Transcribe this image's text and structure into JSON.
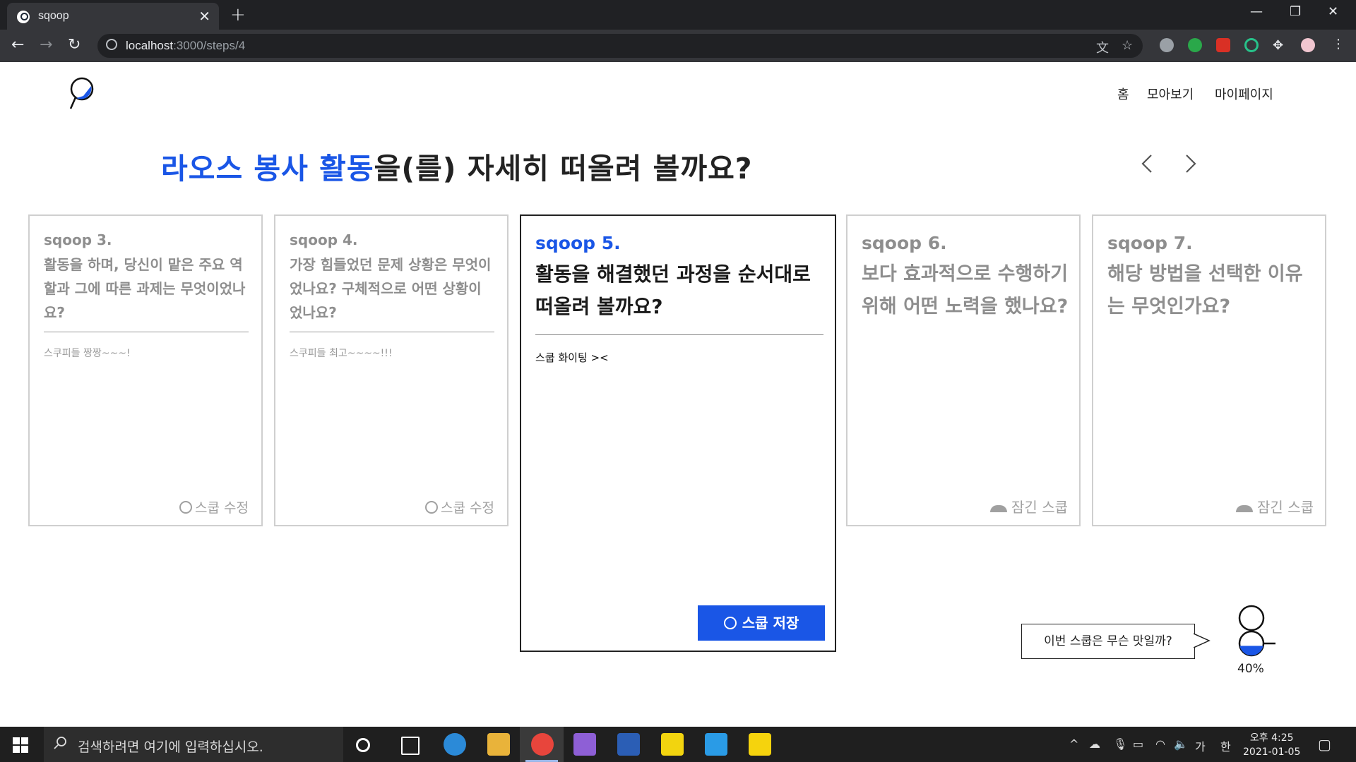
{
  "browser": {
    "tab_title": "sqoop",
    "url_host": "localhost",
    "url_path": ":3000/steps/4",
    "new_tab": "+",
    "close_tab": "✕"
  },
  "nav": {
    "home": "홈",
    "collection": "모아보기",
    "mypage": "마이페이지"
  },
  "heading": {
    "accent": "라오스 봉사 활동",
    "rest": "을(를) 자세히 떠올려 볼까요?"
  },
  "cards": [
    {
      "num": "sqoop 3.",
      "question": "활동을 하며, 당신이 맡은 주요 역할과 그에 따른 과제는 무엇이었나요?",
      "answer": "스쿠피들 짱짱~~~!",
      "action": "스쿱 수정",
      "state": "done"
    },
    {
      "num": "sqoop 4.",
      "question": "가장 힘들었던 문제 상황은 무엇이었나요? 구체적으로 어떤 상황이었나요?",
      "answer": "스쿠피들 최고~~~~!!!",
      "action": "스쿱 수정",
      "state": "done"
    },
    {
      "num": "sqoop 5.",
      "question": "활동을 해결했던 과정을 순서대로 떠올려 볼까요?",
      "answer": "스쿱 화이팅 ><",
      "action": "스쿱 저장",
      "state": "active"
    },
    {
      "num": "sqoop 6.",
      "question": "보다 효과적으로 수행하기 위해 어떤 노력을 했나요?",
      "action": "잠긴 스쿱",
      "state": "locked"
    },
    {
      "num": "sqoop 7.",
      "question": "해당 방법을 선택한 이유는 무엇인가요?",
      "action": "잠긴 스쿱",
      "state": "locked"
    }
  ],
  "mascot": {
    "bubble": "이번 스쿱은 무슨 맛일까?",
    "progress_percent": 40,
    "progress_label": "40%"
  },
  "taskbar": {
    "search_placeholder": "검색하려면 여기에 입력하십시오.",
    "time": "오후 4:25",
    "date": "2021-01-05",
    "ime_lang": "가",
    "ime_mode": "한"
  },
  "colors": {
    "accent": "#1a56e6",
    "chrome_dark": "#202124",
    "chrome_toolbar": "#35363a",
    "taskbar": "#1f1f1f"
  }
}
